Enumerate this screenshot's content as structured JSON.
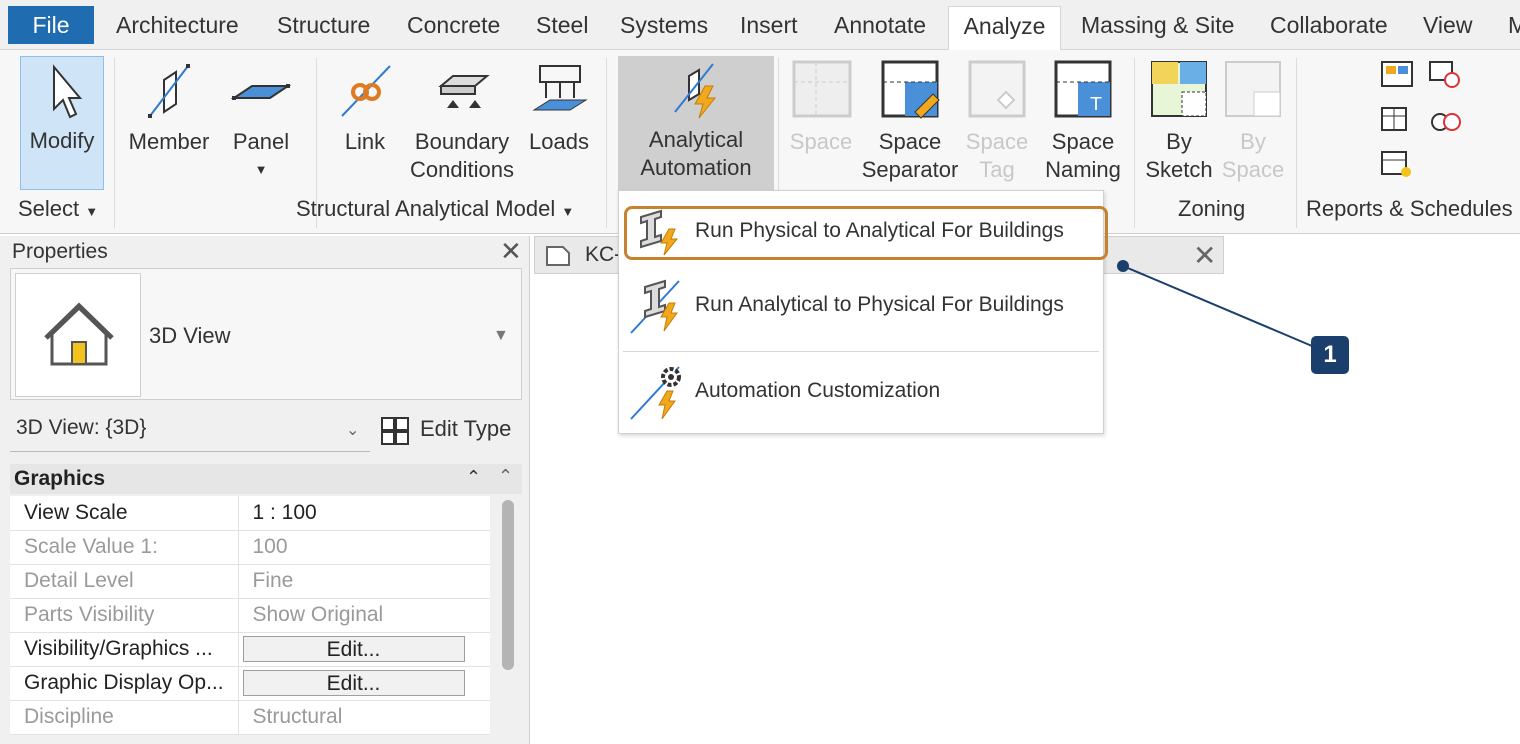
{
  "tabs": [
    {
      "label": "File"
    },
    {
      "label": "Architecture"
    },
    {
      "label": "Structure"
    },
    {
      "label": "Concrete"
    },
    {
      "label": "Steel"
    },
    {
      "label": "Systems"
    },
    {
      "label": "Insert"
    },
    {
      "label": "Annotate"
    },
    {
      "label": "Analyze"
    },
    {
      "label": "Massing & Site"
    },
    {
      "label": "Collaborate"
    },
    {
      "label": "View"
    },
    {
      "label": "M"
    }
  ],
  "active_tab": "Analyze",
  "ribbon": {
    "modify": "Modify",
    "select_panel": "Select",
    "member": "Member",
    "panel": "Panel",
    "link": "Link",
    "boundary_1": "Boundary",
    "boundary_2": "Conditions",
    "loads": "Loads",
    "structural_panel": "Structural Analytical Model",
    "automation_1": "Analytical",
    "automation_2": "Automation",
    "space": "Space",
    "space_sep_1": "Space",
    "space_sep_2": "Separator",
    "space_tag_1": "Space",
    "space_tag_2": "Tag",
    "space_naming_1": "Space",
    "space_naming_2": "Naming",
    "by_sketch_1": "By",
    "by_sketch_2": "Sketch",
    "by_space_1": "By",
    "by_space_2": "Space",
    "zoning_panel": "Zoning",
    "reports_panel": "Reports & Schedules"
  },
  "dropdown": {
    "item1": "Run Physical to Analytical For Buildings",
    "item2": "Run Analytical to Physical For Buildings",
    "item3": "Automation Customization"
  },
  "callout": "1",
  "properties": {
    "title": "Properties",
    "type_name": "3D View",
    "instance": "3D View: {3D}",
    "edit_type": "Edit Type",
    "section": "Graphics",
    "rows": [
      {
        "key": "View Scale",
        "value": "1 : 100"
      },
      {
        "key": "Scale Value    1:",
        "value": "100"
      },
      {
        "key": "Detail Level",
        "value": "Fine"
      },
      {
        "key": "Parts Visibility",
        "value": "Show Original"
      },
      {
        "key": "Visibility/Graphics ...",
        "value": "Edit..."
      },
      {
        "key": "Graphic Display Op...",
        "value": "Edit..."
      },
      {
        "key": "Discipline",
        "value": "Structural"
      }
    ]
  },
  "view_tab": "KC-"
}
